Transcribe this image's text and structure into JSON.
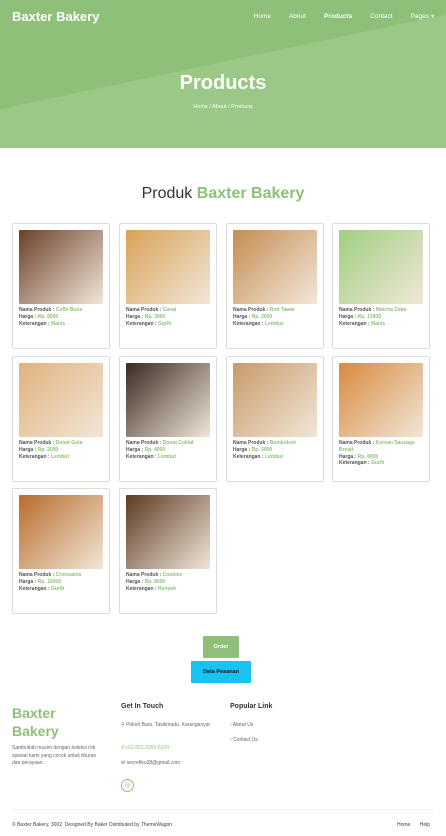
{
  "brand": "Baxter Bakery",
  "nav": {
    "home": "Home",
    "about": "About",
    "products": "Products",
    "contact": "Contact",
    "pages": "Pages"
  },
  "hero": {
    "title": "Products",
    "crumb": "Home / About / Products"
  },
  "section": {
    "prefix": "Produk",
    "highlight": "Baxter Bakery"
  },
  "labels": {
    "name": "Nama Produk :",
    "price": "Harga :",
    "note": "Keterangan :"
  },
  "products": [
    {
      "name": "Coffe Buns",
      "price": "Rp. 8500",
      "note": "Manis",
      "color": "#6b3f2a"
    },
    {
      "name": "Canai",
      "price": "Rp. 3000",
      "note": "Gurih",
      "color": "#d8a256"
    },
    {
      "name": "Roti Tawar",
      "price": "Rp. 2000",
      "note": "Lembut",
      "color": "#c68d52"
    },
    {
      "name": "Matcha Cake",
      "price": "Rp. 13000",
      "note": "Manis",
      "color": "#9fcf7e"
    },
    {
      "name": "Donat Gula",
      "price": "Rp. 2000",
      "note": "Lembut",
      "color": "#e0b27d"
    },
    {
      "name": "Donat Coklat",
      "price": "Rp. 4000",
      "note": "Lembut",
      "color": "#3a2a22"
    },
    {
      "name": "Bomboloni",
      "price": "Rp. 5000",
      "note": "Lembut",
      "color": "#c89a6a"
    },
    {
      "name": "Korean Sausage Bread",
      "price": "Rp. 8000",
      "note": "Gurih",
      "color": "#d98a3f"
    },
    {
      "name": "Croissants",
      "price": "Rp. 15000",
      "note": "Gurih",
      "color": "#b86c2a"
    },
    {
      "name": "Cookies",
      "price": "Rp. 8000",
      "note": "Renyah",
      "color": "#5a3a22"
    }
  ],
  "buttons": {
    "order": "Order",
    "data": "Data Pesanan"
  },
  "footer": {
    "brand": "Baxter Bakery",
    "desc": "Sambutlah musim dengan koleksi roti spesial kami yang cocok untuk liburan dan perayaan.",
    "touch_title": "Get In Touch",
    "address": "Pokoh Baru, Tasikmadu, Karanganyar",
    "phone": "+62 821-2269-5324",
    "email": "secrefiko28@gmail.com",
    "links_title": "Popular Link",
    "links": [
      "About Us",
      "Contact Us"
    ],
    "copyright": "© Baxter Bakery, 3002. Designed By Baker Distributed by ThemeWagon",
    "home": "Home",
    "help": "Help"
  },
  "colors": {
    "accent": "#8fc07a",
    "button_blue": "#18c4ef"
  }
}
